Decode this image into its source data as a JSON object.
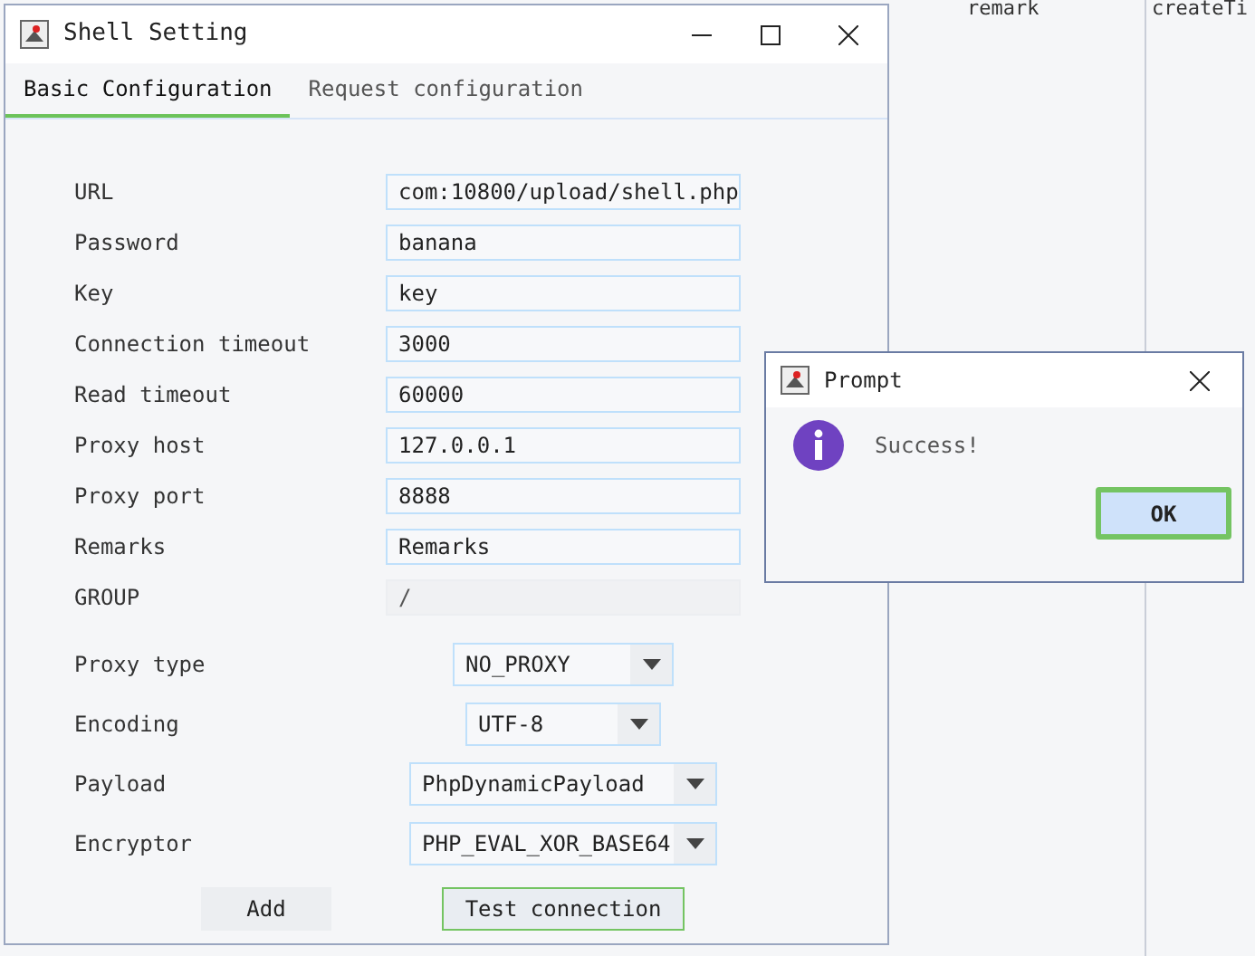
{
  "background_table": {
    "columns": [
      "remark",
      "createTi"
    ]
  },
  "window": {
    "title": "Shell Setting",
    "tabs": [
      {
        "label": "Basic Configuration",
        "selected": true
      },
      {
        "label": "Request configuration",
        "selected": false
      }
    ],
    "fields": [
      {
        "label": "URL",
        "value": "com:10800/upload/shell.php",
        "disabled": false
      },
      {
        "label": "Password",
        "value": "banana",
        "disabled": false
      },
      {
        "label": "Key",
        "value": "key",
        "disabled": false
      },
      {
        "label": "Connection timeout",
        "value": "3000",
        "disabled": false
      },
      {
        "label": "Read timeout",
        "value": "60000",
        "disabled": false
      },
      {
        "label": "Proxy host",
        "value": "127.0.0.1",
        "disabled": false
      },
      {
        "label": "Proxy port",
        "value": "8888",
        "disabled": false
      },
      {
        "label": "Remarks",
        "value": "Remarks",
        "disabled": false
      },
      {
        "label": "GROUP",
        "value": "/",
        "disabled": true
      }
    ],
    "dropdowns": [
      {
        "label": "Proxy type",
        "value": "NO_PROXY"
      },
      {
        "label": "Encoding",
        "value": "UTF-8"
      },
      {
        "label": "Payload",
        "value": "PhpDynamicPayload"
      },
      {
        "label": "Encryptor",
        "value": "PHP_EVAL_XOR_BASE64"
      }
    ],
    "buttons": [
      {
        "label": "Add",
        "focused": false
      },
      {
        "label": "Test connection",
        "focused": true
      }
    ]
  },
  "prompt": {
    "title": "Prompt",
    "message": "Success!",
    "button": "OK"
  }
}
